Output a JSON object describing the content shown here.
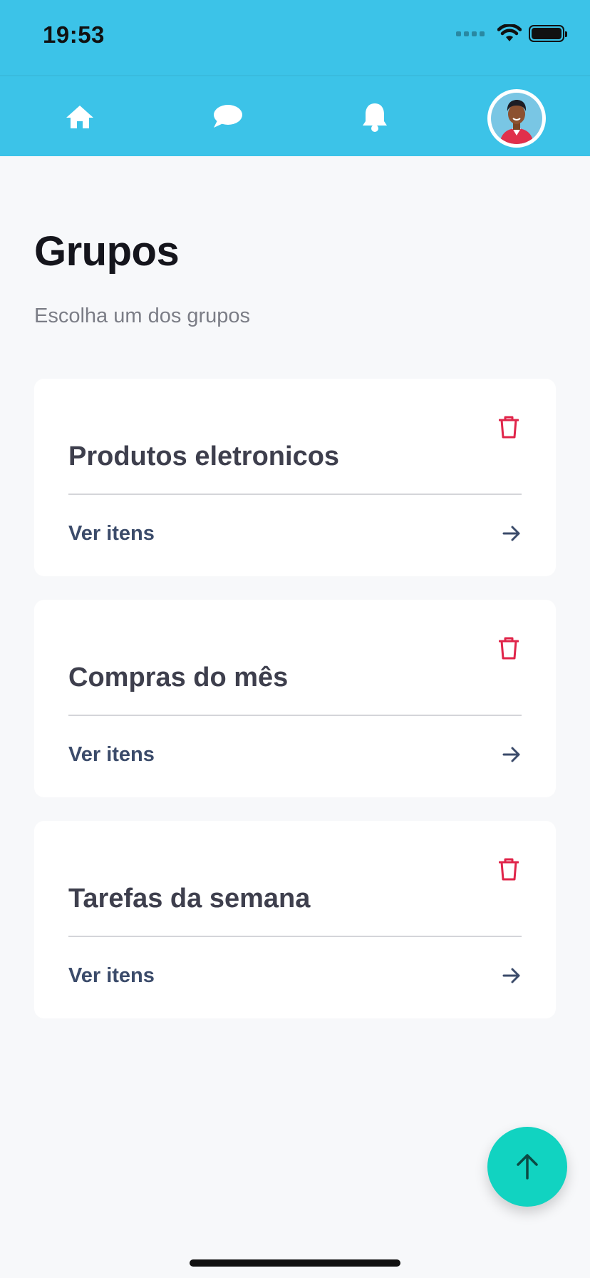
{
  "status_bar": {
    "time": "19:53"
  },
  "navbar": {
    "icons": [
      "home-icon",
      "chat-icon",
      "bell-icon",
      "avatar"
    ],
    "color": "#3cc3e8"
  },
  "page": {
    "title": "Grupos",
    "subtitle": "Escolha um dos grupos"
  },
  "groups": [
    {
      "name": "Produtos eletronicos",
      "link_label": "Ver itens"
    },
    {
      "name": "Compras do mês",
      "link_label": "Ver itens"
    },
    {
      "name": "Tarefas da semana",
      "link_label": "Ver itens"
    }
  ],
  "colors": {
    "accent": "#3cc3e8",
    "delete": "#e0254a",
    "fab": "#11d3c1",
    "link": "#3b4b6a"
  },
  "fab": {
    "icon": "arrow-up-icon"
  }
}
